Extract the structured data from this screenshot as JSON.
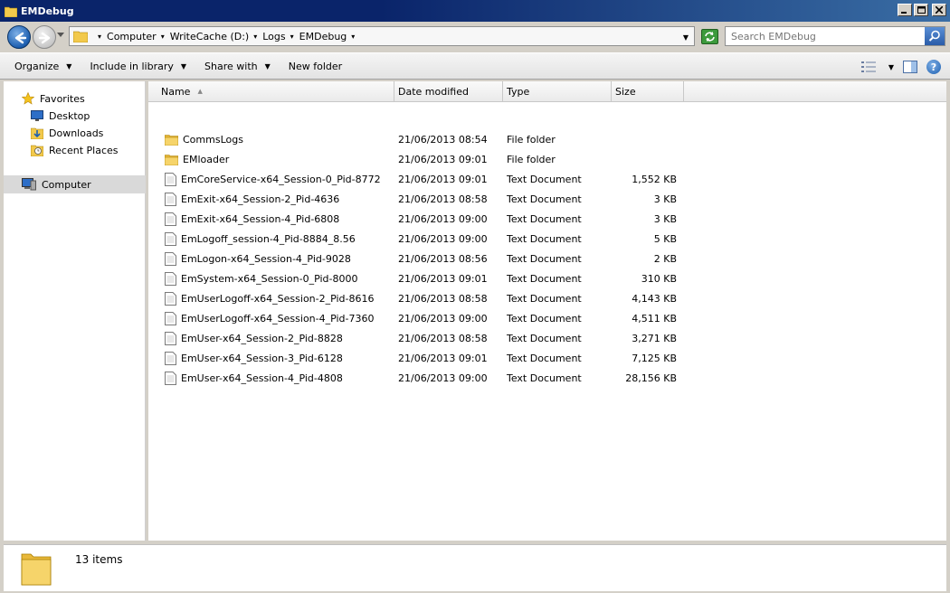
{
  "window": {
    "title": "EMDebug"
  },
  "address": {
    "crumbs": [
      "Computer",
      "WriteCache (D:)",
      "Logs",
      "EMDebug"
    ]
  },
  "search": {
    "placeholder": "Search EMDebug"
  },
  "toolbar": {
    "organize": "Organize",
    "include_in_library": "Include in library",
    "share_with": "Share with",
    "new_folder": "New folder"
  },
  "nav": {
    "favorites": "Favorites",
    "desktop": "Desktop",
    "downloads": "Downloads",
    "recent_places": "Recent Places",
    "computer": "Computer"
  },
  "columns": {
    "name": "Name",
    "date_modified": "Date modified",
    "type": "Type",
    "size": "Size"
  },
  "files": [
    {
      "name": "CommsLogs",
      "date": "21/06/2013 08:54",
      "type": "File folder",
      "size": "",
      "icon": "folder"
    },
    {
      "name": "EMloader",
      "date": "21/06/2013 09:01",
      "type": "File folder",
      "size": "",
      "icon": "folder"
    },
    {
      "name": "EmCoreService-x64_Session-0_Pid-8772",
      "date": "21/06/2013 09:01",
      "type": "Text Document",
      "size": "1,552 KB",
      "icon": "text"
    },
    {
      "name": "EmExit-x64_Session-2_Pid-4636",
      "date": "21/06/2013 08:58",
      "type": "Text Document",
      "size": "3 KB",
      "icon": "text"
    },
    {
      "name": "EmExit-x64_Session-4_Pid-6808",
      "date": "21/06/2013 09:00",
      "type": "Text Document",
      "size": "3 KB",
      "icon": "text"
    },
    {
      "name": "EmLogoff_session-4_Pid-8884_8.56",
      "date": "21/06/2013 09:00",
      "type": "Text Document",
      "size": "5 KB",
      "icon": "text"
    },
    {
      "name": "EmLogon-x64_Session-4_Pid-9028",
      "date": "21/06/2013 08:56",
      "type": "Text Document",
      "size": "2 KB",
      "icon": "text"
    },
    {
      "name": "EmSystem-x64_Session-0_Pid-8000",
      "date": "21/06/2013 09:01",
      "type": "Text Document",
      "size": "310 KB",
      "icon": "text"
    },
    {
      "name": "EmUserLogoff-x64_Session-2_Pid-8616",
      "date": "21/06/2013 08:58",
      "type": "Text Document",
      "size": "4,143 KB",
      "icon": "text"
    },
    {
      "name": "EmUserLogoff-x64_Session-4_Pid-7360",
      "date": "21/06/2013 09:00",
      "type": "Text Document",
      "size": "4,511 KB",
      "icon": "text"
    },
    {
      "name": "EmUser-x64_Session-2_Pid-8828",
      "date": "21/06/2013 08:58",
      "type": "Text Document",
      "size": "3,271 KB",
      "icon": "text"
    },
    {
      "name": "EmUser-x64_Session-3_Pid-6128",
      "date": "21/06/2013 09:01",
      "type": "Text Document",
      "size": "7,125 KB",
      "icon": "text"
    },
    {
      "name": "EmUser-x64_Session-4_Pid-4808",
      "date": "21/06/2013 09:00",
      "type": "Text Document",
      "size": "28,156 KB",
      "icon": "text"
    }
  ],
  "status": {
    "item_count": "13 items"
  },
  "colors": {
    "titlebar": "#0a246a",
    "folder": "#e8b83a",
    "selection": "#d9d9d9"
  }
}
